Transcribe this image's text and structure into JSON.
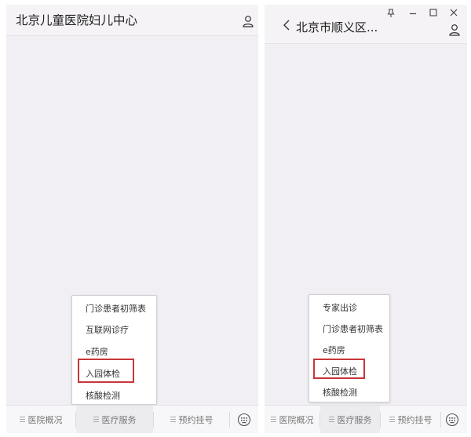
{
  "left": {
    "title": "北京儿童医院妇儿中心",
    "tabs": [
      "医院概况",
      "医疗服务",
      "预约挂号"
    ],
    "menu": [
      "门诊患者初筛表",
      "互联网诊疗",
      "e药房",
      "入园体检",
      "核酸检测"
    ],
    "highlighted_item": "入园体检"
  },
  "right": {
    "title": "北京市顺义区...",
    "window_controls": [
      "pin-icon",
      "minimize-icon",
      "maximize-icon",
      "close-icon"
    ],
    "tabs": [
      "医院概况",
      "医疗服务",
      "预约挂号"
    ],
    "menu": [
      "专家出诊",
      "门诊患者初筛表",
      "e药房",
      "入园体检",
      "核酸检测"
    ],
    "highlighted_item": "入园体检"
  },
  "colors": {
    "highlight": "#c8363a",
    "background": "#f1eff3"
  }
}
